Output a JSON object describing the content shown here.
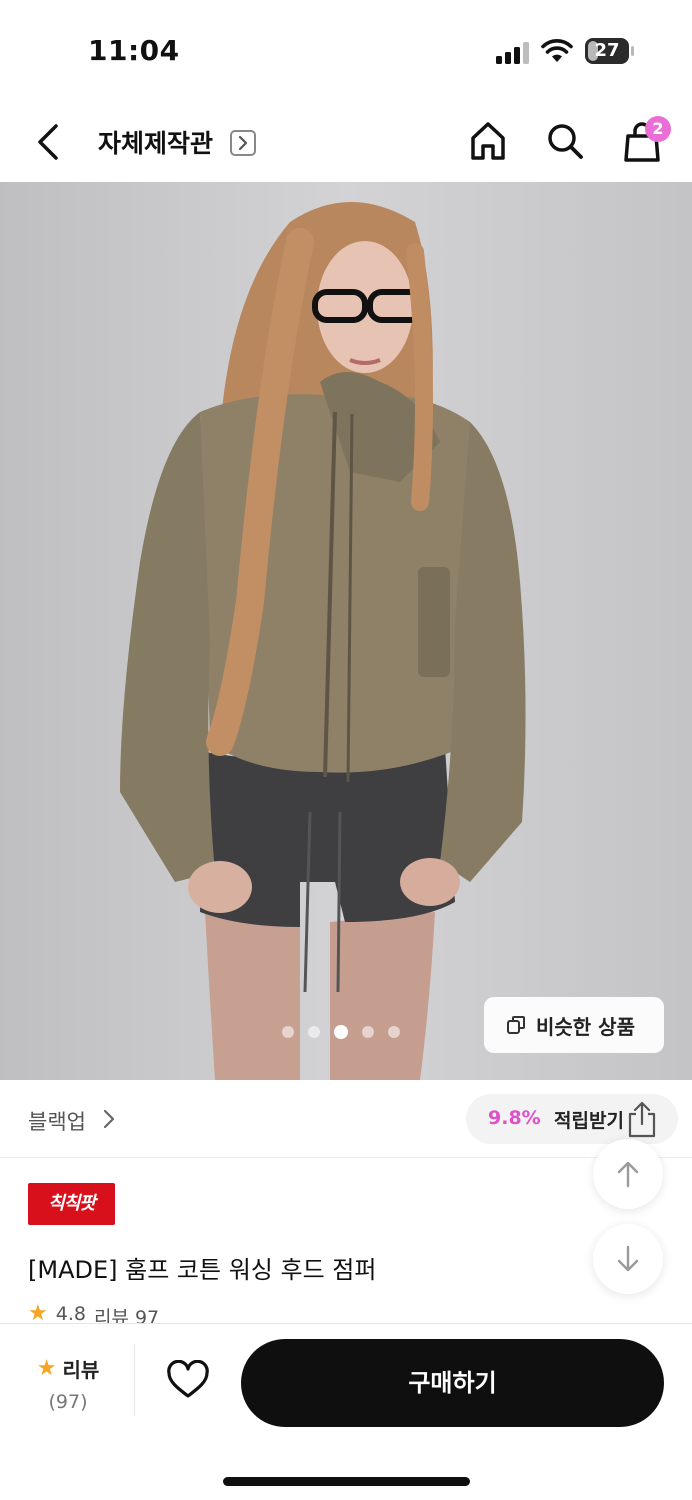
{
  "status_bar": {
    "time": "11:04",
    "battery": "27",
    "battery_level": 0.27
  },
  "nav": {
    "store_name": "자체제작관",
    "cart_count": "2"
  },
  "hero": {
    "slide_count": 5,
    "active_slide": 3,
    "similar_label": "비슷한 상품"
  },
  "brand": {
    "name": "블랙업",
    "reward_rate": "9.8%",
    "reward_label": "적립받기"
  },
  "product": {
    "promo_badge": "칙칙팟",
    "title": "[MADE] 훔프 코튼 워싱 후드 점퍼",
    "rating": "4.8",
    "review_text": "리뷰 97"
  },
  "bottom": {
    "review_label": "리뷰",
    "review_count": "(97)",
    "buy_label": "구매하기"
  },
  "colors": {
    "accent": "#e96fd6",
    "reward": "#e050c8",
    "promo": "#d7101c",
    "star": "#f5a524",
    "buy_bg": "#0f0f0f"
  }
}
